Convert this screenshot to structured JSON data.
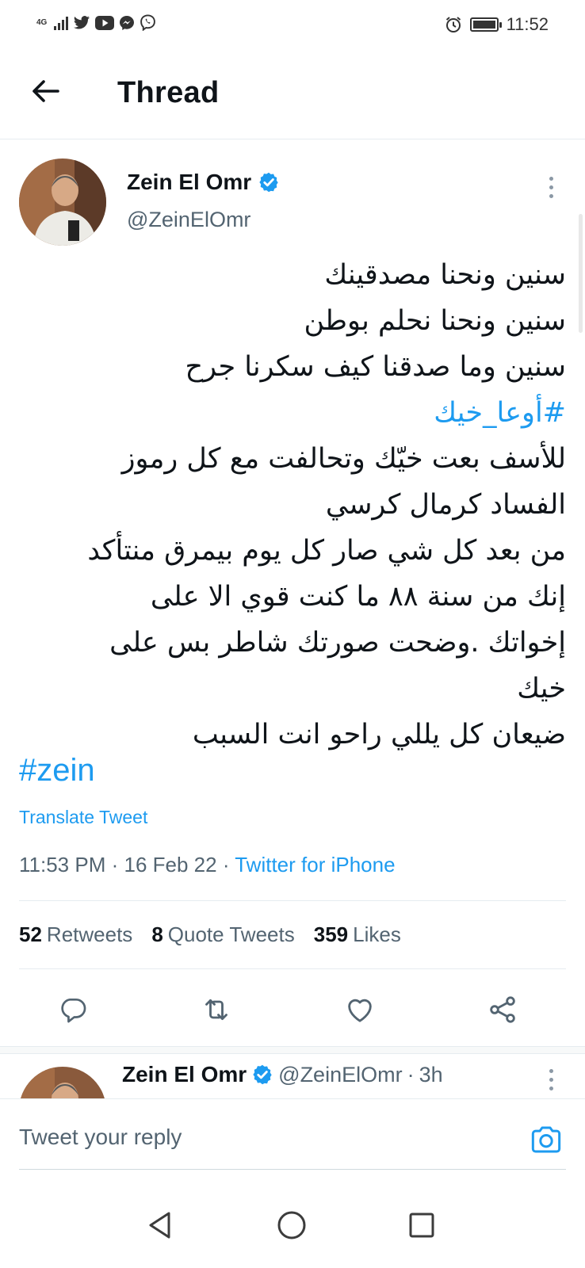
{
  "status_bar": {
    "network": "4G",
    "time": "11:52",
    "icons": [
      "signal-icon",
      "twitter-icon",
      "youtube-icon",
      "messenger-icon",
      "viber-icon",
      "alarm-icon",
      "battery-icon"
    ]
  },
  "header": {
    "title": "Thread",
    "back_icon": "arrow-left-icon"
  },
  "tweet": {
    "author_name": "Zein El Omr",
    "handle": "@ZeinElOmr",
    "verified": true,
    "lines": [
      "سنين ونحنا مصدقينك",
      "سنين ونحنا نحلم بوطن",
      "سنين وما صدقنا كيف سكرنا جرح",
      "#أوعا_خيك",
      "للأسف بعت خيّك وتحالفت مع كل رموز",
      "الفساد كرمال كرسي",
      "من بعد كل شي صار كل يوم بيمرق منتأكد",
      "إنك من سنة ٨٨  ما كنت قوي الا على",
      "إخواتك .وضحت صورتك  شاطر بس على",
      "خيك",
      "ضيعان كل يللي راحو  انت السبب"
    ],
    "latin_hashtag": "#zein",
    "translate_label": "Translate Tweet",
    "time": "11:53 PM",
    "date": "16 Feb 22",
    "source": "Twitter for iPhone",
    "stats": {
      "retweets_count": "52",
      "retweets_label": "Retweets",
      "quotes_count": "8",
      "quotes_label": "Quote Tweets",
      "likes_count": "359",
      "likes_label": "Likes"
    }
  },
  "actions": [
    "reply-icon",
    "retweet-icon",
    "like-icon",
    "share-icon"
  ],
  "next_tweet": {
    "author_name": "Zein El Omr",
    "handle": "@ZeinElOmr",
    "age": "3h",
    "separator": "·"
  },
  "reply_bar": {
    "placeholder": "Tweet your reply"
  },
  "nav_bar": [
    "back-triangle-icon",
    "home-circle-icon",
    "recents-square-icon"
  ],
  "colors": {
    "accent": "#1d9bf0",
    "text": "#0f1419",
    "secondary_text": "#536471",
    "divider": "#e6ecf0"
  }
}
